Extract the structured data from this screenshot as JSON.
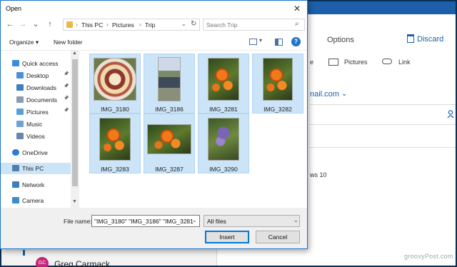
{
  "mail": {
    "tab_options": "Options",
    "discard_label": "Discard",
    "insert_letter": "e",
    "insert_pictures": "Pictures",
    "insert_link": "Link",
    "email_domain": "nail.com",
    "body_fragment": "ws 10",
    "contact_initials": "GC",
    "contact_name": "Greg Carmack",
    "watermark": "groovyPost.com",
    "accent_color": "#1d5fa8"
  },
  "dialog": {
    "title": "Open",
    "close_glyph": "✕",
    "nav": {
      "back_glyph": "←",
      "forward_glyph": "→",
      "recent_glyph": "⌄",
      "up_glyph": "↑",
      "breadcrumb": [
        "This PC",
        "Pictures",
        "Trip"
      ],
      "separator": "›",
      "refresh_glyph": "↻"
    },
    "search": {
      "placeholder": "Search Trip",
      "icon": "search-icon"
    },
    "toolbar": {
      "organize": "Organize ▾",
      "new_folder": "New folder",
      "help": "?"
    },
    "navpane": [
      {
        "label": "Quick access",
        "icon": "star-icon",
        "pinned": false,
        "selected": false,
        "indent": 0
      },
      {
        "label": "Desktop",
        "icon": "desktop-icon",
        "pinned": true,
        "selected": false,
        "indent": 1
      },
      {
        "label": "Downloads",
        "icon": "download-icon",
        "pinned": true,
        "selected": false,
        "indent": 1
      },
      {
        "label": "Documents",
        "icon": "documents-icon",
        "pinned": true,
        "selected": false,
        "indent": 1
      },
      {
        "label": "Pictures",
        "icon": "pictures-icon",
        "pinned": true,
        "selected": false,
        "indent": 1
      },
      {
        "label": "Music",
        "icon": "music-icon",
        "pinned": false,
        "selected": false,
        "indent": 1
      },
      {
        "label": "Videos",
        "icon": "videos-icon",
        "pinned": false,
        "selected": false,
        "indent": 1
      },
      {
        "label": "OneDrive",
        "icon": "cloud-icon",
        "pinned": false,
        "selected": false,
        "indent": 0
      },
      {
        "label": "This PC",
        "icon": "computer-icon",
        "pinned": false,
        "selected": true,
        "indent": 0
      },
      {
        "label": "Network",
        "icon": "network-icon",
        "pinned": false,
        "selected": false,
        "indent": 0
      },
      {
        "label": "Camera",
        "icon": "camera-icon",
        "pinned": false,
        "selected": false,
        "indent": 0
      }
    ],
    "files": [
      {
        "name": "IMG_3180",
        "thumb": "pie",
        "selected": true
      },
      {
        "name": "IMG_3186",
        "thumb": "person",
        "selected": true
      },
      {
        "name": "IMG_3281",
        "thumb": "flowers-orange",
        "selected": true
      },
      {
        "name": "IMG_3282",
        "thumb": "flowers-orange",
        "selected": true
      },
      {
        "name": "IMG_3283",
        "thumb": "flowers-orange",
        "selected": true
      },
      {
        "name": "IMG_3287",
        "thumb": "flowers-orange",
        "selected": true
      },
      {
        "name": "IMG_3290",
        "thumb": "flowers-purple",
        "selected": true
      }
    ],
    "footer": {
      "file_name_label": "File name:",
      "file_name_value": "\"IMG_3180\" \"IMG_3186\" \"IMG_3281",
      "file_type": "All files",
      "insert": "Insert",
      "cancel": "Cancel"
    }
  }
}
